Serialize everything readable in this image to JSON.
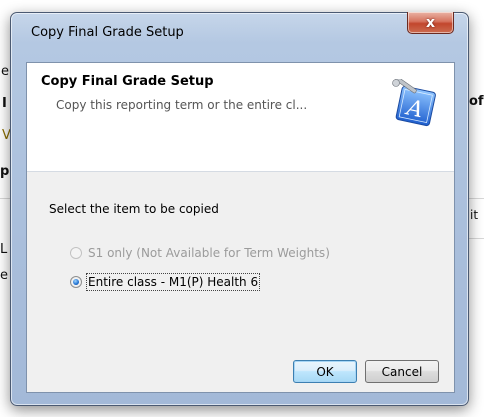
{
  "background": {
    "fragments": [
      "e",
      "I",
      "V",
      "p",
      "L",
      "e",
      "of",
      "it",
      "I"
    ]
  },
  "dialog": {
    "title": "Copy Final Grade Setup",
    "close_glyph": "x",
    "header": {
      "title": "Copy Final Grade Setup",
      "subtitle": "Copy this reporting term or the entire cl..."
    },
    "group_label": "Select the item to be copied",
    "options": [
      {
        "label": "S1 only (Not Available for Term Weights)",
        "enabled": false,
        "selected": false
      },
      {
        "label": "Entire class - M1(P) Health 6",
        "enabled": true,
        "selected": true
      }
    ],
    "buttons": {
      "ok": "OK",
      "cancel": "Cancel"
    },
    "icon": "app-installer-icon"
  },
  "colors": {
    "window_frame": "#a9bedb",
    "close_button": "#c2462d",
    "client_bg": "#f0f0f0",
    "header_bg": "#ffffff"
  }
}
